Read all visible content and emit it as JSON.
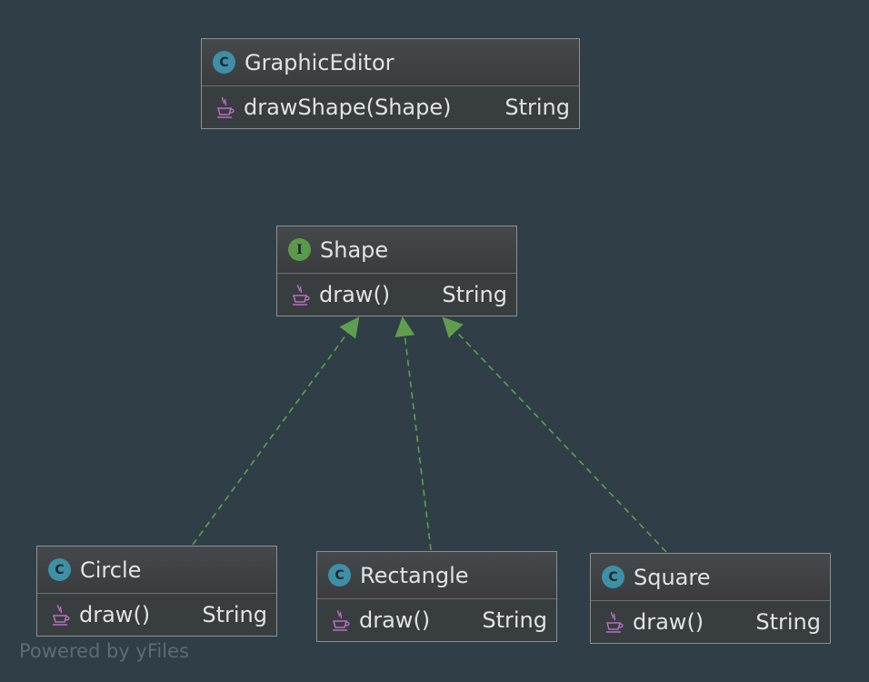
{
  "nodes": {
    "graphic_editor": {
      "kind": "class",
      "badge": "C",
      "name": "GraphicEditor",
      "methods": [
        {
          "name": "drawShape(Shape)",
          "return_type": "String"
        }
      ]
    },
    "shape": {
      "kind": "interface",
      "badge": "I",
      "name": "Shape",
      "methods": [
        {
          "name": "draw()",
          "return_type": "String"
        }
      ]
    },
    "circle": {
      "kind": "class",
      "badge": "C",
      "name": "Circle",
      "methods": [
        {
          "name": "draw()",
          "return_type": "String"
        }
      ]
    },
    "rectangle": {
      "kind": "class",
      "badge": "C",
      "name": "Rectangle",
      "methods": [
        {
          "name": "draw()",
          "return_type": "String"
        }
      ]
    },
    "square": {
      "kind": "class",
      "badge": "C",
      "name": "Square",
      "methods": [
        {
          "name": "draw()",
          "return_type": "String"
        }
      ]
    }
  },
  "edges": [
    {
      "from": "Circle",
      "to": "Shape",
      "type": "realization"
    },
    {
      "from": "Rectangle",
      "to": "Shape",
      "type": "realization"
    },
    {
      "from": "Square",
      "to": "Shape",
      "type": "realization"
    }
  ],
  "colors": {
    "background": "#303f47",
    "class_badge": "#3f8fa6",
    "interface_badge": "#5a9a4a",
    "realization_edge": "#5e9e4e"
  },
  "icons": {
    "class_badge": "class-c-icon",
    "interface_badge": "interface-i-icon",
    "method": "java-cup-icon"
  },
  "watermark": "Powered by yFiles"
}
